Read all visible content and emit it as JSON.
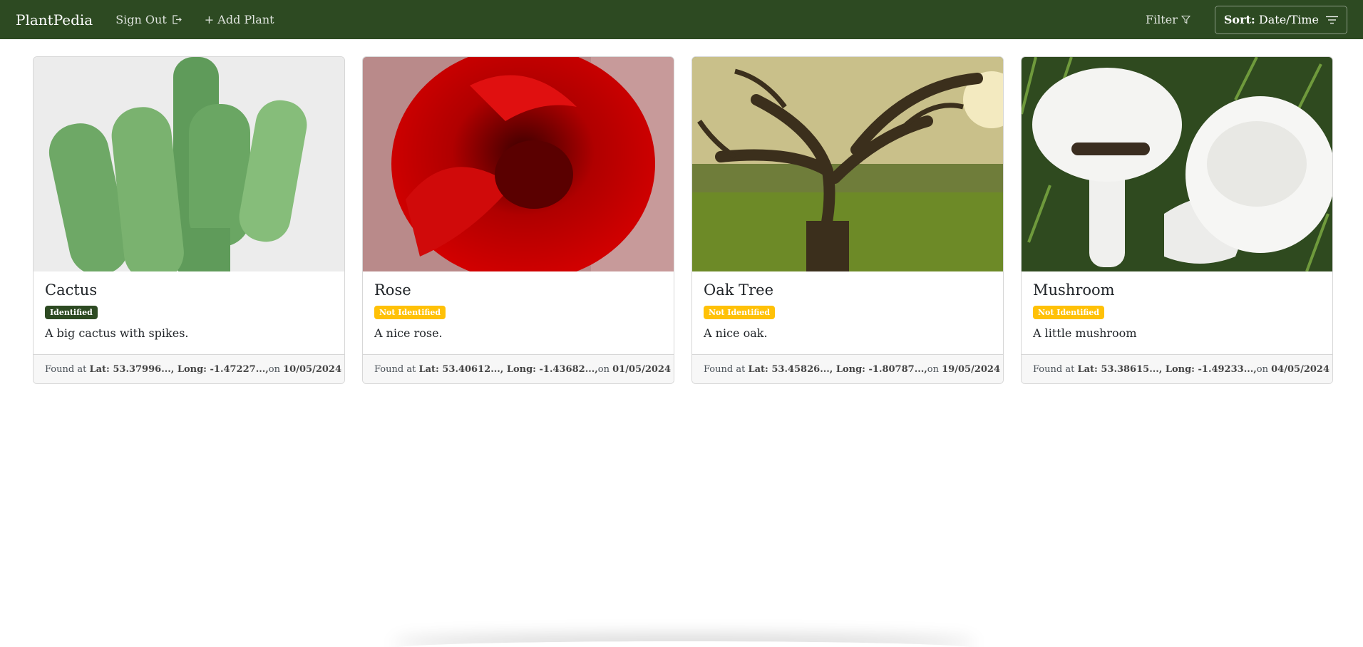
{
  "navbar": {
    "brand": "PlantPedia",
    "sign_out": "Sign Out",
    "add_plant": "+ Add Plant",
    "filter": "Filter",
    "sort_prefix": "Sort:",
    "sort_value": "Date/Time",
    "icons": {
      "sign_out": "sign-out-icon",
      "filter": "filter-funnel-icon",
      "sort": "sort-lines-icon"
    }
  },
  "colors": {
    "nav_bg": "#2d4a22",
    "identified": "#2d4a22",
    "not_identified": "#ffc107"
  },
  "cards": [
    {
      "title": "Cactus",
      "badge": "Identified",
      "status": "identified",
      "description": "A big cactus with spikes.",
      "found_prefix": "Found at",
      "coords": "Lat: 53.37996..., Long: -1.47227...,",
      "on_word": "on",
      "date": "10/05/2024",
      "image": "cactus photo"
    },
    {
      "title": "Rose",
      "badge": "Not Identified",
      "status": "not-identified",
      "description": "A nice rose.",
      "found_prefix": "Found at",
      "coords": "Lat: 53.40612..., Long: -1.43682...,",
      "on_word": "on",
      "date": "01/05/2024",
      "image": "red rose photo"
    },
    {
      "title": "Oak Tree",
      "badge": "Not Identified",
      "status": "not-identified",
      "description": "A nice oak.",
      "found_prefix": "Found at",
      "coords": "Lat: 53.45826..., Long: -1.80787...,",
      "on_word": "on",
      "date": "19/05/2024",
      "image": "oak tree photo"
    },
    {
      "title": "Mushroom",
      "badge": "Not Identified",
      "status": "not-identified",
      "description": "A little mushroom",
      "found_prefix": "Found at",
      "coords": "Lat: 53.38615..., Long: -1.49233...,",
      "on_word": "on",
      "date": "04/05/2024",
      "image": "mushroom photo"
    }
  ]
}
